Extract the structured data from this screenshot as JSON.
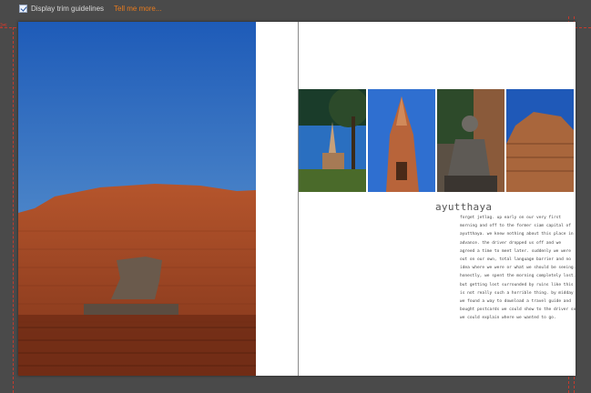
{
  "toolbar": {
    "checkbox_label": "Display trim guidelines",
    "checkbox_checked": true,
    "help_link": "Tell me more..."
  },
  "page": {
    "title": "ayutthaya",
    "body": "forget jetlag. up early on our very first morning and off to the former siam capital of ayutthaya. we knew nothing about this place in advance. the driver dropped us off and we agreed a time to meet later. suddenly we were out on our own, total language barrier and no idea where we were or what we should be seeing. honestly, we spent the morning completely lost. but getting lost surrounded by ruins like this is not really such a horrible thing. by midday we found a way to download a travel guide and bought postcards we could show to the driver so we could explain where we wanted to go."
  },
  "colors": {
    "trim": "#c43a2e",
    "link": "#e87b1e",
    "background": "#4a4a4a"
  },
  "icons": [
    "checkbox-checked-icon",
    "scissors-icon"
  ]
}
